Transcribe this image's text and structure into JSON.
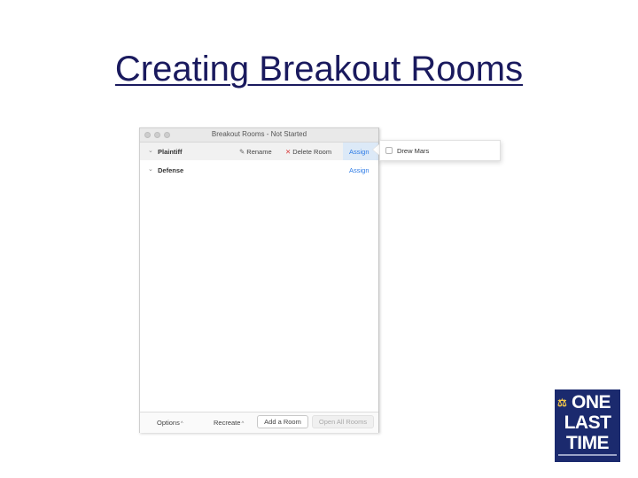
{
  "slide": {
    "title": "Creating Breakout Rooms"
  },
  "window": {
    "title": "Breakout Rooms - Not Started",
    "rooms": [
      {
        "name": "Plaintiff",
        "rename_label": "Rename",
        "delete_label": "Delete Room",
        "assign_label": "Assign",
        "selected": true
      },
      {
        "name": "Defense",
        "assign_label": "Assign",
        "selected": false
      }
    ],
    "bottom": {
      "options_label": "Options",
      "recreate_label": "Recreate",
      "add_room_label": "Add a Room",
      "open_all_label": "Open All Rooms"
    }
  },
  "assign_popup": {
    "participants": [
      {
        "name": "Drew Mars",
        "checked": false
      }
    ]
  },
  "logo": {
    "line1": "ONE",
    "line2": "LAST",
    "line3": "TIME"
  },
  "colors": {
    "title": "#1a1a5e",
    "accent": "#2d7be6",
    "delete": "#d93b3b",
    "logo_bg": "#1b2a6e"
  }
}
